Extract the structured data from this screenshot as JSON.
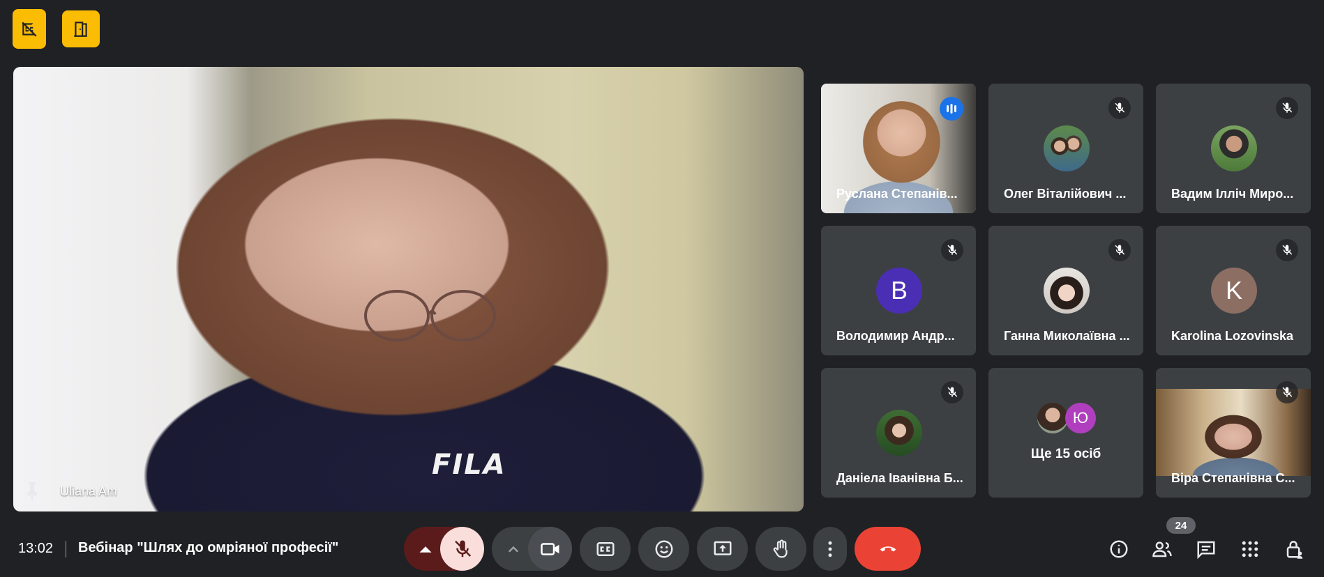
{
  "top_buttons": [
    {
      "icon": "captions-off-icon"
    },
    {
      "icon": "door-icon"
    }
  ],
  "main_video": {
    "participant_name": "Uliana Am",
    "shirt_text": "FILA",
    "pinned": true
  },
  "tiles": [
    {
      "name": "Руслана Степанів...",
      "speaking": true
    },
    {
      "name": "Олег Віталійович ...",
      "muted": true
    },
    {
      "name": "Вадим Ілліч Миро...",
      "muted": true
    },
    {
      "name": "Володимир Андр...",
      "muted": true,
      "initial": "В",
      "avatar_color": "#4a2fb5"
    },
    {
      "name": "Ганна Миколаївна ...",
      "muted": true
    },
    {
      "name": "Karolina Lozovinska",
      "muted": true,
      "initial": "K",
      "avatar_color": "#8d6e63"
    },
    {
      "name": "Даніела Іванівна Б...",
      "muted": true
    },
    {
      "more_label": "Ще 15 осіб",
      "avatar_initial": "Ю"
    },
    {
      "name": "Віра Степанівна С...",
      "muted": true
    }
  ],
  "bottom_bar": {
    "time": "13:02",
    "meeting_title": "Вебінар \"Шлях до омріяної професії\"",
    "participant_count": "24"
  },
  "controls": {
    "mic": "mic-off-icon",
    "camera": "videocam-icon",
    "captions": "closed-captions-icon",
    "reactions": "emoji-icon",
    "present": "present-screen-icon",
    "raise_hand": "hand-icon",
    "more": "more-vert-icon",
    "leave": "call-end-icon"
  },
  "colors": {
    "background": "#202124",
    "tile": "#3c4043",
    "accent_yellow": "#fbbc04",
    "active_border": "#8ab4f8",
    "hangup": "#ea4335",
    "mic_off_bg": "#f9dedc"
  }
}
